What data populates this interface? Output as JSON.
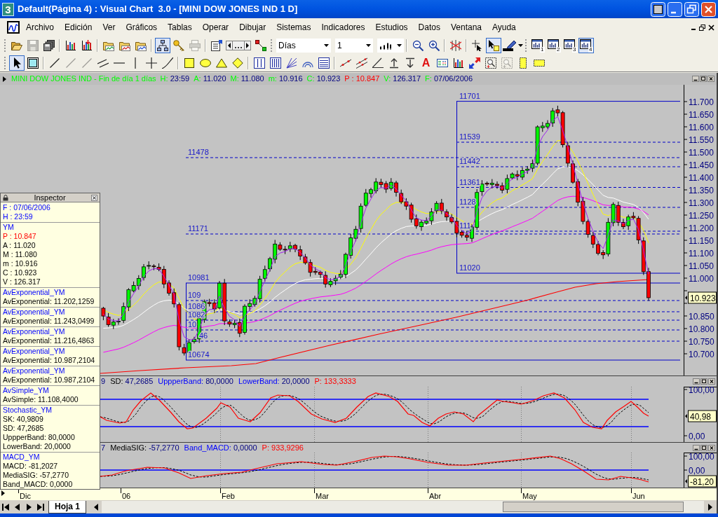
{
  "window": {
    "app_icon": "3",
    "title": "Default(Página 4) : Visual Chart  3.0 - [MINI DOW JONES IND 1 D]"
  },
  "menu": [
    "Archivo",
    "Edición",
    "Ver",
    "Gráficos",
    "Tablas",
    "Operar",
    "Dibujar",
    "Sistemas",
    "Indicadores",
    "Estudios",
    "Datos",
    "Ventana",
    "Ayuda"
  ],
  "toolbar_1": {
    "buttons": [
      {
        "pressed": false,
        "disabled": false
      },
      {
        "pressed": false,
        "disabled": true
      },
      {
        "pressed": false,
        "disabled": false
      },
      {
        "pressed": false,
        "disabled": false
      },
      {
        "pressed": false,
        "disabled": false
      },
      {
        "pressed": false,
        "disabled": false
      },
      {
        "pressed": false,
        "disabled": false
      },
      {
        "pressed": false,
        "disabled": false
      },
      {
        "pressed": true,
        "disabled": false
      },
      {
        "pressed": false,
        "disabled": false
      },
      {
        "pressed": false,
        "disabled": true
      },
      {
        "pressed": false,
        "disabled": false
      },
      {
        "pressed": false,
        "disabled": false
      },
      {
        "pressed": false,
        "disabled": false
      },
      {
        "pressed": false,
        "disabled": false
      },
      {
        "pressed": false,
        "disabled": false
      },
      {
        "pressed": false,
        "disabled": false
      },
      {
        "pressed": false,
        "disabled": false
      },
      {
        "pressed": true,
        "disabled": false
      },
      {
        "pressed": false,
        "disabled": false
      },
      {
        "pressed": false,
        "disabled": false,
        "label": "1"
      },
      {
        "pressed": false,
        "disabled": false,
        "label": "2"
      },
      {
        "pressed": false,
        "disabled": false,
        "label": "3"
      },
      {
        "pressed": true,
        "disabled": false,
        "label": "4"
      }
    ],
    "period_select": {
      "value": "Días"
    },
    "count_select": {
      "value": "1"
    }
  },
  "toolbar_2": {
    "buttons": [
      {
        "pressed": true,
        "disabled": false
      },
      {
        "pressed": false,
        "disabled": false
      },
      {
        "pressed": false,
        "disabled": false
      },
      {
        "pressed": false,
        "disabled": true
      },
      {
        "pressed": false,
        "disabled": true
      },
      {
        "pressed": false,
        "disabled": false
      },
      {
        "pressed": false,
        "disabled": false
      },
      {
        "pressed": false,
        "disabled": false
      },
      {
        "pressed": false,
        "disabled": false
      },
      {
        "pressed": false,
        "disabled": false
      },
      {
        "pressed": false,
        "disabled": false
      },
      {
        "pressed": false,
        "disabled": false
      },
      {
        "pressed": false,
        "disabled": false
      },
      {
        "pressed": false,
        "disabled": false
      },
      {
        "pressed": false,
        "disabled": false
      },
      {
        "pressed": false,
        "disabled": false
      },
      {
        "pressed": false,
        "disabled": false
      },
      {
        "pressed": false,
        "disabled": false
      },
      {
        "pressed": false,
        "disabled": false
      },
      {
        "pressed": false,
        "disabled": false
      },
      {
        "pressed": false,
        "disabled": false
      },
      {
        "pressed": false,
        "disabled": false
      },
      {
        "pressed": false,
        "disabled": false
      },
      {
        "pressed": false,
        "disabled": false
      },
      {
        "pressed": false,
        "disabled": false,
        "label": "A"
      },
      {
        "pressed": false,
        "disabled": false
      },
      {
        "pressed": false,
        "disabled": false
      },
      {
        "pressed": false,
        "disabled": false
      },
      {
        "pressed": false,
        "disabled": false
      },
      {
        "pressed": false,
        "disabled": true
      },
      {
        "pressed": false,
        "disabled": false
      },
      {
        "pressed": false,
        "disabled": false
      }
    ]
  },
  "chart_header": {
    "title": "MINI DOW JONES IND - Fin de día 1 días",
    "fields": [
      {
        "label": "H:",
        "value": "23:59",
        "kind": "plain"
      },
      {
        "label": "A:",
        "value": "11.020",
        "kind": "plain"
      },
      {
        "label": "M:",
        "value": "11.080",
        "kind": "plain"
      },
      {
        "label": "m:",
        "value": "10.916",
        "kind": "plain"
      },
      {
        "label": "C:",
        "value": "10.923",
        "kind": "plain"
      },
      {
        "label": "P :",
        "value": "10.847",
        "kind": "alert"
      },
      {
        "label": "V:",
        "value": "126.317",
        "kind": "plain"
      },
      {
        "label": "F:",
        "value": "07/06/2006",
        "kind": "plain"
      }
    ]
  },
  "main_chart": {
    "levels": [
      "11701",
      "11539",
      "11478",
      "11442",
      "11361",
      "1128",
      "11171",
      "111",
      "11020",
      "10981",
      "109",
      "1086",
      "1082",
      "10",
      "46",
      "10674"
    ],
    "price_axis": [
      "11.700",
      "11.650",
      "11.600",
      "11.550",
      "11.500",
      "11.450",
      "11.400",
      "11.350",
      "11.300",
      "11.250",
      "11.200",
      "11.150",
      "11.100",
      "11.050",
      "11.000",
      "10.850",
      "10.800",
      "10.750",
      "10.700"
    ],
    "last_price": "10.923"
  },
  "stochastic": {
    "fragment": "9",
    "fields": [
      {
        "label": "SD:",
        "value": "47,2685",
        "kind": "line"
      },
      {
        "label": "UppperBand:",
        "value": "80,0000",
        "kind": "band"
      },
      {
        "label": "LowerBand:",
        "value": "20,0000",
        "kind": "band"
      },
      {
        "label": "P:",
        "value": "133,3333",
        "kind": "alert"
      }
    ],
    "axis": [
      "100,00",
      "0,00"
    ],
    "last_value": "40,98"
  },
  "macd": {
    "fragment": "7",
    "fields": [
      {
        "label": "MediaSIG:",
        "value": "-57,2770",
        "kind": "line"
      },
      {
        "label": "Band_MACD:",
        "value": "0,0000",
        "kind": "band"
      },
      {
        "label": "P:",
        "value": "933,9296",
        "kind": "alert"
      }
    ],
    "axis": [
      "100,00",
      "0,00"
    ],
    "last_value": "-81,20"
  },
  "date_axis": [
    "Dic",
    "06",
    "Feb",
    "Mar",
    "Abr",
    "May",
    "Jun"
  ],
  "sheets": [
    {
      "label": "Hoja 1",
      "selected": true
    }
  ],
  "inspector": {
    "title": "Inspector",
    "sections": [
      {
        "lines": [
          {
            "text": "F : 07/06/2006",
            "kind": "header"
          },
          {
            "text": "H : 23:59",
            "kind": "header"
          }
        ]
      },
      {
        "lines": [
          {
            "text": "YM",
            "kind": "header"
          },
          {
            "text": "P : 10.847",
            "kind": "price"
          },
          {
            "text": "A : 11.020",
            "kind": "value"
          },
          {
            "text": "M : 11.080",
            "kind": "value"
          },
          {
            "text": "m : 10.916",
            "kind": "value"
          },
          {
            "text": "C : 10.923",
            "kind": "value"
          },
          {
            "text": "V : 126.317",
            "kind": "value"
          }
        ]
      },
      {
        "lines": [
          {
            "text": "AvExponential_YM",
            "kind": "header"
          },
          {
            "text": "AvExponential: 11.202,1259",
            "kind": "value"
          }
        ]
      },
      {
        "lines": [
          {
            "text": "AvExponential_YM",
            "kind": "header"
          },
          {
            "text": "AvExponential: 11.243,0499",
            "kind": "value"
          }
        ]
      },
      {
        "lines": [
          {
            "text": "AvExponential_YM",
            "kind": "header"
          },
          {
            "text": "AvExponential: 11.216,4863",
            "kind": "value"
          }
        ]
      },
      {
        "lines": [
          {
            "text": "AvExponential_YM",
            "kind": "header"
          },
          {
            "text": "AvExponential: 10.987,2104",
            "kind": "value"
          }
        ]
      },
      {
        "lines": [
          {
            "text": "AvExponential_YM",
            "kind": "header"
          },
          {
            "text": "AvExponential: 10.987,2104",
            "kind": "value"
          }
        ]
      },
      {
        "lines": [
          {
            "text": "AvSimple_YM",
            "kind": "header"
          },
          {
            "text": "AvSimple: 11.108,4000",
            "kind": "value"
          }
        ]
      },
      {
        "lines": [
          {
            "text": "Stochastic_YM",
            "kind": "header"
          },
          {
            "text": "SK: 40,9809",
            "kind": "value"
          },
          {
            "text": "SD: 47,2685",
            "kind": "value"
          },
          {
            "text": "UppperBand: 80,0000",
            "kind": "value"
          },
          {
            "text": "LowerBand: 20,0000",
            "kind": "value"
          }
        ]
      },
      {
        "lines": [
          {
            "text": "MACD_YM",
            "kind": "header"
          },
          {
            "text": "MACD: -81,2027",
            "kind": "value"
          },
          {
            "text": "MediaSIG: -57,2770",
            "kind": "value"
          },
          {
            "text": "Band_MACD: 0,0000",
            "kind": "value"
          }
        ]
      }
    ]
  }
}
